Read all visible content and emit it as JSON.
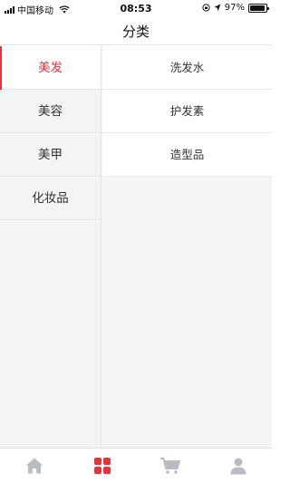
{
  "status_bar": {
    "carrier": "中国移动",
    "time": "08:53",
    "battery": "97%",
    "battery_level": 0.97
  },
  "nav": {
    "title": "分类"
  },
  "sidebar": {
    "items": [
      {
        "label": "美发",
        "active": true
      },
      {
        "label": "美容",
        "active": false
      },
      {
        "label": "美甲",
        "active": false
      },
      {
        "label": "化妆品",
        "active": false
      }
    ]
  },
  "subcategories": {
    "items": [
      {
        "label": "洗发水"
      },
      {
        "label": "护发素"
      },
      {
        "label": "造型品"
      }
    ]
  },
  "tab_bar": {
    "tabs": [
      {
        "icon": "home-icon",
        "active": false
      },
      {
        "icon": "category-grid-icon",
        "active": true
      },
      {
        "icon": "cart-icon",
        "active": false
      },
      {
        "icon": "user-icon",
        "active": false
      }
    ]
  },
  "colors": {
    "accent": "#e8333a",
    "inactive_icon": "#b9bcc2",
    "sidebar_bg": "#f4f4f4",
    "page_bg": "#f5f5f5"
  }
}
